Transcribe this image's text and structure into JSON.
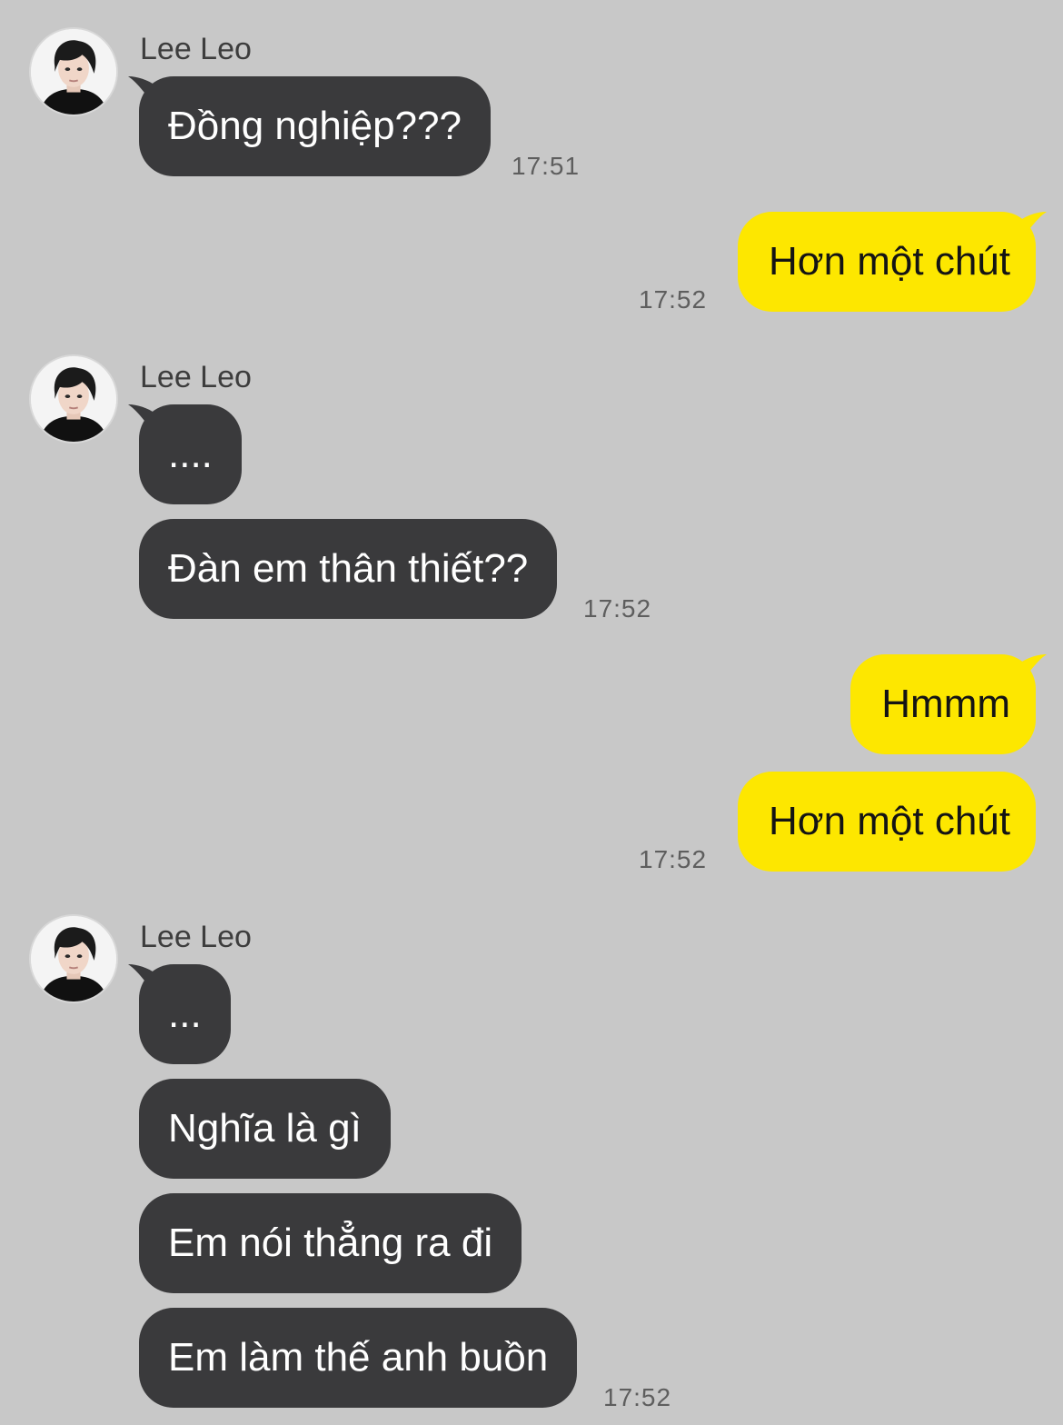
{
  "contact": {
    "name": "Lee Leo",
    "avatar_icon": "profile-photo"
  },
  "colors": {
    "background": "#c8c8c8",
    "incoming_bubble": "#3a3a3c",
    "outgoing_bubble": "#fde700"
  },
  "groups": [
    {
      "sender": "Lee Leo",
      "direction": "incoming",
      "messages": [
        "Đồng nghiệp???"
      ],
      "time": "17:51"
    },
    {
      "sender": "me",
      "direction": "outgoing",
      "messages": [
        "Hơn một chút"
      ],
      "time": "17:52"
    },
    {
      "sender": "Lee Leo",
      "direction": "incoming",
      "messages": [
        "....",
        "Đàn em thân thiết??"
      ],
      "time": "17:52"
    },
    {
      "sender": "me",
      "direction": "outgoing",
      "messages": [
        "Hmmm",
        "Hơn một chút"
      ],
      "time": "17:52"
    },
    {
      "sender": "Lee Leo",
      "direction": "incoming",
      "messages": [
        "...",
        "Nghĩa là gì",
        "Em nói thẳng ra đi",
        "Em làm thế anh buồn"
      ],
      "time": "17:52"
    }
  ]
}
